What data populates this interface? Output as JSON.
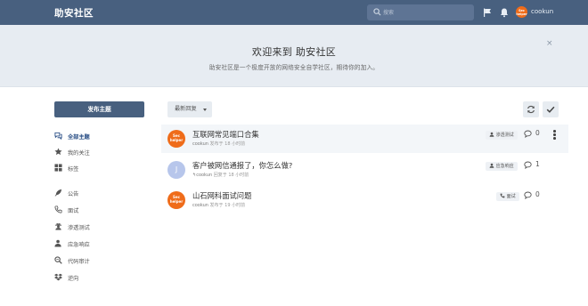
{
  "header": {
    "logo": "助安社区",
    "search_placeholder": "搜索",
    "username": "cookun",
    "avatar_text": "Sec helper"
  },
  "banner": {
    "title": "欢迎来到 助安社区",
    "subtitle": "助安社区是一个极度开放的网络安全自学社区，期待你的加入。",
    "close": "×"
  },
  "sidebar": {
    "compose": "发布主题",
    "items": [
      {
        "label": "全部主题",
        "icon": "comments-icon",
        "active": true
      },
      {
        "label": "我的关注",
        "icon": "star-icon",
        "active": false
      },
      {
        "label": "标签",
        "icon": "tags-grid-icon",
        "active": false
      },
      {
        "label": "公告",
        "icon": "megaphone-icon",
        "active": false
      },
      {
        "label": "面试",
        "icon": "phone-icon",
        "active": false
      },
      {
        "label": "渗透测试",
        "icon": "user-secret-icon",
        "active": false
      },
      {
        "label": "应急响应",
        "icon": "user-shield-icon",
        "active": false
      },
      {
        "label": "代码审计",
        "icon": "search-code-icon",
        "active": false
      },
      {
        "label": "逆向",
        "icon": "dropbox-icon",
        "active": false
      }
    ]
  },
  "toolbar": {
    "sort": "最新回复"
  },
  "discussions": [
    {
      "title": "互联网常见端口合集",
      "author": "cookun",
      "meta": "发布于 18 小时前",
      "tag": "渗透测试",
      "replies": "0",
      "avatar": "logo",
      "avatar_text": "Sec helper"
    },
    {
      "title": "客户被网信通报了，你怎么做?",
      "author": "↰cookun",
      "meta": "回复于 18 小时前",
      "tag": "应急响应",
      "replies": "1",
      "avatar": "letter",
      "avatar_text": "J"
    },
    {
      "title": "山石网科面试问题",
      "author": "cookun",
      "meta": "发布于 19 小时前",
      "tag": "面试",
      "replies": "0",
      "avatar": "logo",
      "avatar_text": "Sec helper"
    }
  ],
  "colors": {
    "header": "#48607f",
    "banner": "#e7ecf2",
    "accent": "#2a4f86",
    "avatar_orange": "#ef6c1a"
  }
}
